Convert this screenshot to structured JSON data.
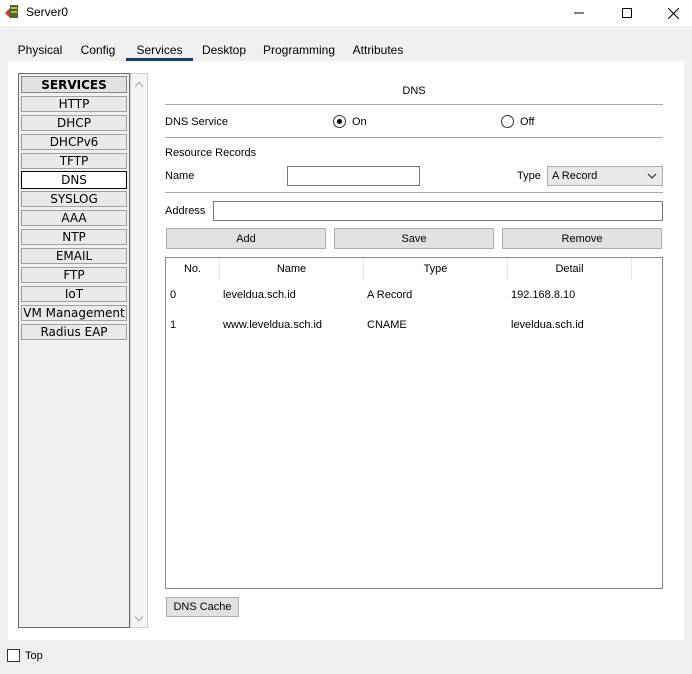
{
  "window": {
    "title": "Server0"
  },
  "tabs": [
    {
      "label": "Physical",
      "active": false
    },
    {
      "label": "Config",
      "active": false
    },
    {
      "label": "Services",
      "active": true
    },
    {
      "label": "Desktop",
      "active": false
    },
    {
      "label": "Programming",
      "active": false
    },
    {
      "label": "Attributes",
      "active": false
    }
  ],
  "services": {
    "header": "SERVICES",
    "items": [
      "HTTP",
      "DHCP",
      "DHCPv6",
      "TFTP",
      "DNS",
      "SYSLOG",
      "AAA",
      "NTP",
      "EMAIL",
      "FTP",
      "IoT",
      "VM Management",
      "Radius EAP"
    ],
    "selected": "DNS"
  },
  "dns": {
    "title": "DNS",
    "service_label": "DNS Service",
    "on_label": "On",
    "off_label": "Off",
    "service_state": "On",
    "records_label": "Resource Records",
    "name_label": "Name",
    "name_value": "",
    "type_label": "Type",
    "type_value": "A Record",
    "address_label": "Address",
    "address_value": "",
    "add_button": "Add",
    "save_button": "Save",
    "remove_button": "Remove",
    "cache_button": "DNS Cache",
    "table": {
      "columns": [
        "No.",
        "Name",
        "Type",
        "Detail"
      ],
      "rows": [
        {
          "no": "0",
          "name": "leveldua.sch.id",
          "type": "A Record",
          "detail": "192.168.8.10"
        },
        {
          "no": "1",
          "name": "www.leveldua.sch.id",
          "type": "CNAME",
          "detail": "leveldua.sch.id"
        }
      ]
    }
  },
  "footer": {
    "top_label": "Top",
    "top_checked": false
  },
  "colors": {
    "tab_underline": "#203a5e",
    "panel_bg": "#ffffff",
    "window_bg": "#f0f0f0"
  }
}
